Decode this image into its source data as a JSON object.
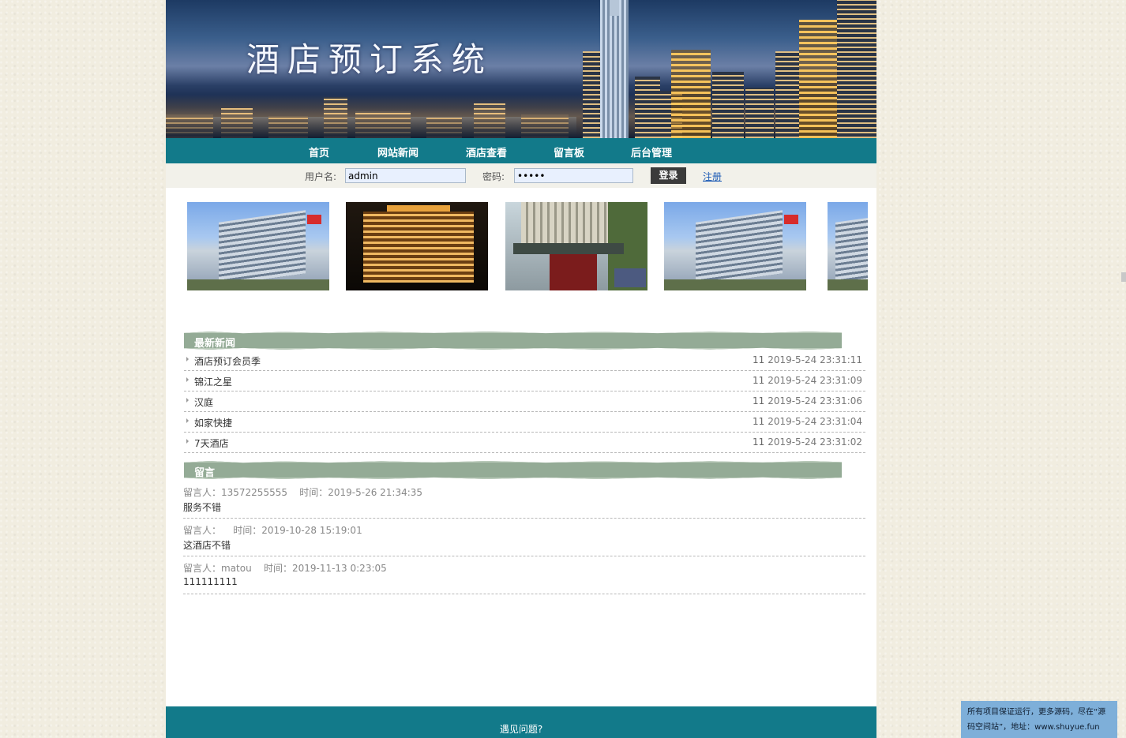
{
  "banner": {
    "title": "酒店预订系统"
  },
  "nav": {
    "items": [
      "首页",
      "网站新闻",
      "酒店查看",
      "留言板",
      "后台管理"
    ]
  },
  "login": {
    "username_label": "用户名:",
    "username_value": "admin",
    "password_label": "密码:",
    "password_value": "•••••",
    "login_button": "登录",
    "register_link": "注册"
  },
  "news": {
    "heading": "最新新闻",
    "items": [
      {
        "title": "酒店预订会员季",
        "count": "11",
        "date": "2019-5-24 23:31:11"
      },
      {
        "title": "锦江之星",
        "count": "11",
        "date": "2019-5-24 23:31:09"
      },
      {
        "title": "汉庭",
        "count": "11",
        "date": "2019-5-24 23:31:06"
      },
      {
        "title": "如家快捷",
        "count": "11",
        "date": "2019-5-24 23:31:04"
      },
      {
        "title": "7天酒店",
        "count": "11",
        "date": "2019-5-24 23:31:02"
      }
    ]
  },
  "messages": {
    "heading": "留言",
    "items": [
      {
        "meta": "留言人：13572255555    时间：2019-5-26 21:34:35",
        "body": "服务不错"
      },
      {
        "meta": "留言人：    时间：2019-10-28 15:19:01",
        "body": "这酒店不错"
      },
      {
        "meta": "留言人：matou    时间：2019-11-13 0:23:05",
        "body": "111111111"
      }
    ]
  },
  "footer": {
    "text": "遇见问题?"
  },
  "notice": {
    "text": "所有项目保证运行，更多源码，尽在“源码空间站”，地址：www.shuyue.fun"
  },
  "colors": {
    "nav_bg": "#127a8a",
    "section_head": "#94ab96",
    "notice_bg": "#7eafd9"
  }
}
